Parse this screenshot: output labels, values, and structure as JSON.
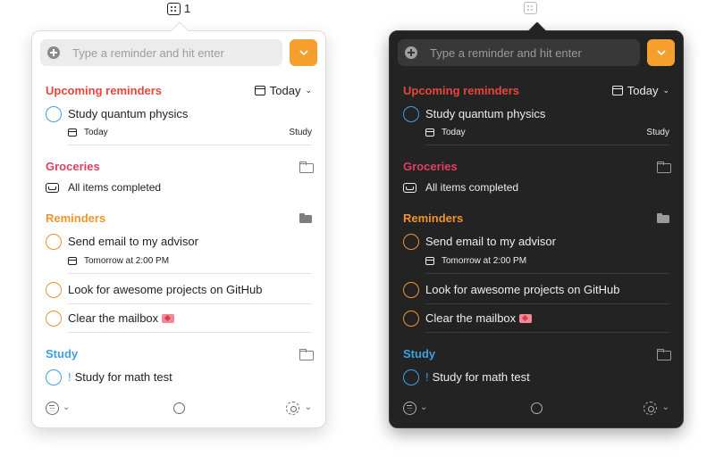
{
  "menubar": {
    "count": "1"
  },
  "colors": {
    "upcoming": "#e8453c",
    "groceries": "#e0405e",
    "reminders": "#f0942c",
    "study": "#3aa3e0",
    "accent_button": "#f5a02c"
  },
  "panels": [
    {
      "theme": "light",
      "search": {
        "placeholder": "Type a reminder and hit enter"
      },
      "upcoming": {
        "title": "Upcoming reminders",
        "filter_label": "Today",
        "items": [
          {
            "text": "Study quantum physics",
            "date": "Today",
            "list": "Study"
          }
        ]
      },
      "groceries": {
        "title": "Groceries",
        "status": "All items completed"
      },
      "reminders": {
        "title": "Reminders",
        "items": [
          {
            "text": "Send email to my advisor",
            "date": "Tomorrow at 2:00 PM"
          },
          {
            "text": "Look for awesome projects on GitHub"
          },
          {
            "text": "Clear the mailbox"
          }
        ]
      },
      "study": {
        "title": "Study",
        "items": [
          {
            "priority": "!",
            "text": "Study for math test"
          }
        ]
      }
    },
    {
      "theme": "dark",
      "search": {
        "placeholder": "Type a reminder and hit enter"
      },
      "upcoming": {
        "title": "Upcoming reminders",
        "filter_label": "Today",
        "items": [
          {
            "text": "Study quantum physics",
            "date": "Today",
            "list": "Study"
          }
        ]
      },
      "groceries": {
        "title": "Groceries",
        "status": "All items completed"
      },
      "reminders": {
        "title": "Reminders",
        "items": [
          {
            "text": "Send email to my advisor",
            "date": "Tomorrow at 2:00 PM"
          },
          {
            "text": "Look for awesome projects on GitHub"
          },
          {
            "text": "Clear the mailbox"
          }
        ]
      },
      "study": {
        "title": "Study",
        "items": [
          {
            "priority": "!",
            "text": "Study for math test"
          }
        ]
      }
    }
  ]
}
